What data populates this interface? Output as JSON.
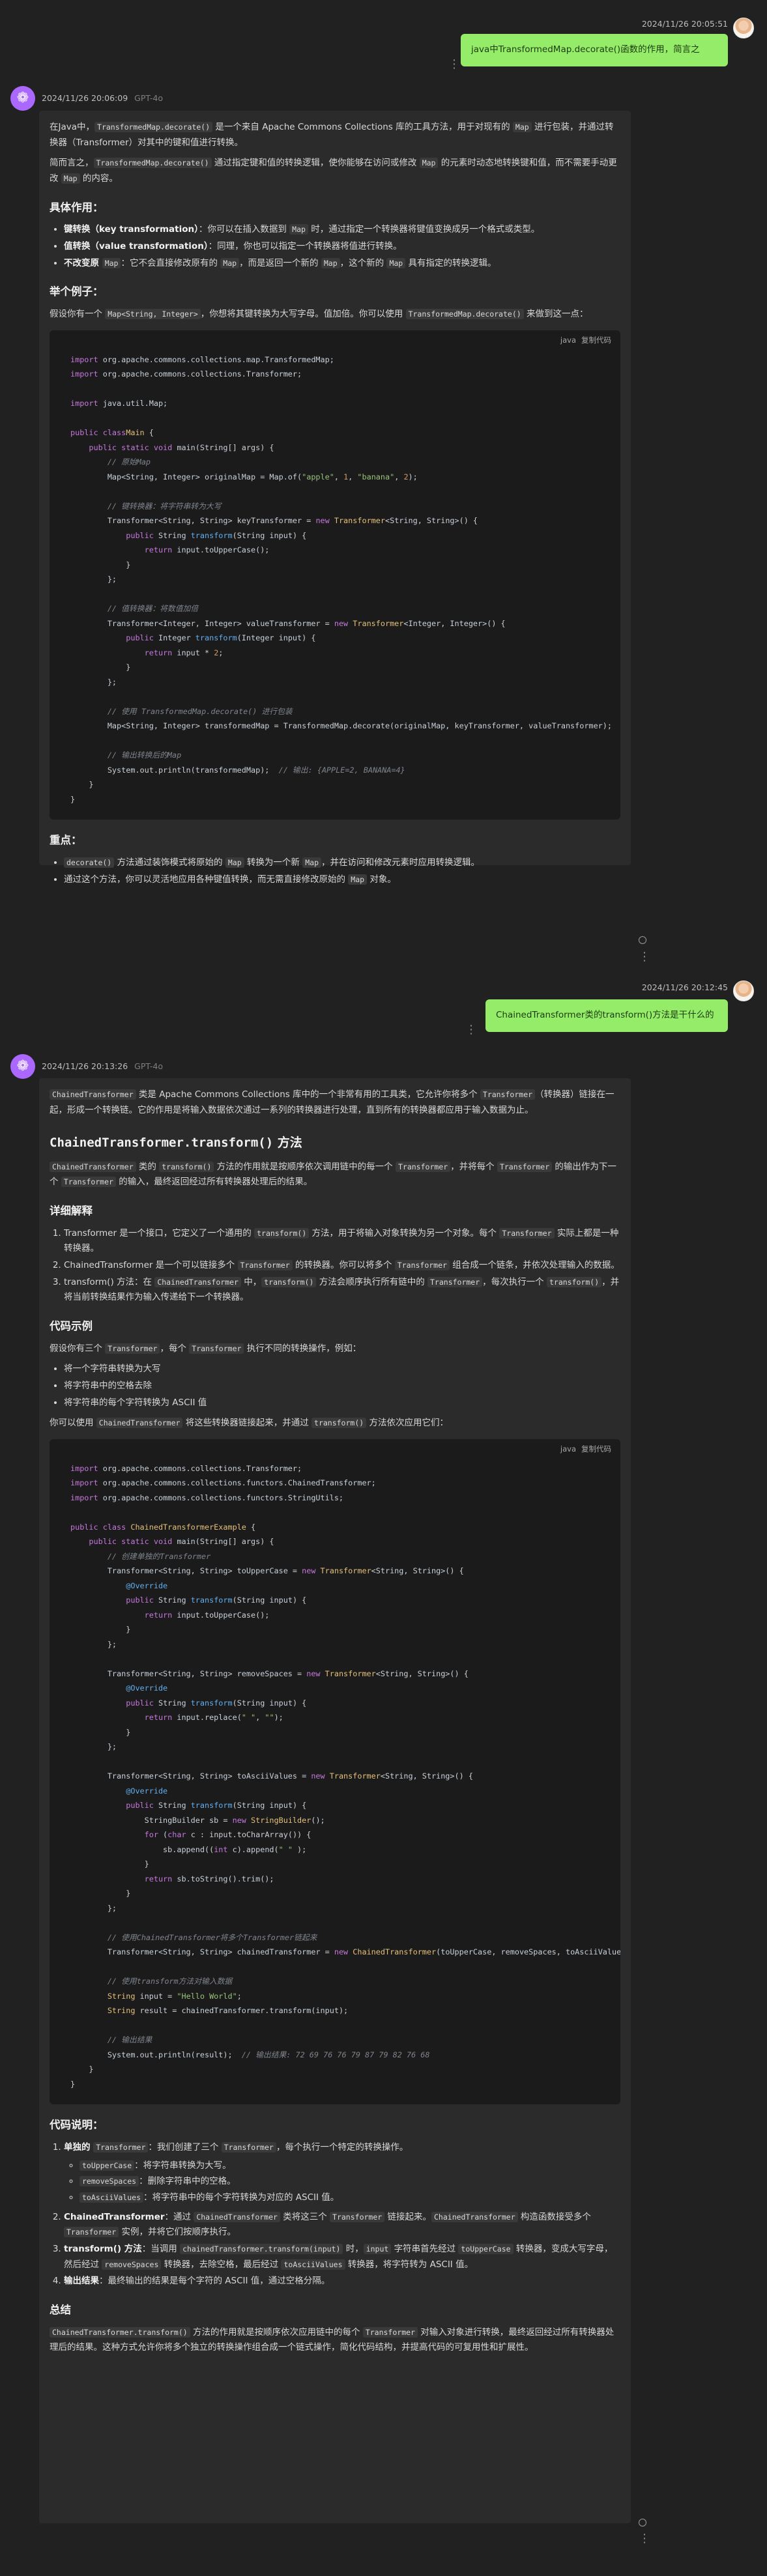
{
  "conversation": [
    {
      "role": "user",
      "timestamp": "2024/11/26 20:05:51",
      "text": "java中TransformedMap.decorate()函数的作用，简言之"
    },
    {
      "role": "assistant",
      "timestamp": "2024/11/26 20:06:09",
      "model": "GPT-4o",
      "p1_a": "在Java中，",
      "p1_code": "TransformedMap.decorate()",
      "p1_b": " 是一个来自 Apache Commons Collections 库的工具方法，用于对现有的 ",
      "p1_code2": "Map",
      "p1_c": " 进行包装，并通过转换器（Transformer）对其中的键和值进行转换。",
      "p2_a": "简而言之，",
      "p2_code": "TransformedMap.decorate()",
      "p2_b": " 通过指定键和值的转换逻辑，使你能够在访问或修改 ",
      "p2_code2": "Map",
      "p2_c": " 的元素时动态地转换键和值，而不需要手动更改 ",
      "p2_code3": "Map",
      "p2_d": " 的内容。",
      "h_role": "具体作用：",
      "role_items": [
        {
          "bold": "键转换（key transformation）",
          "a": "：你可以在插入数据到 ",
          "code": "Map",
          "b": " 时，通过指定一个转换器将键值变换成另一个格式或类型。"
        },
        {
          "bold": "值转换（value transformation）",
          "a": "：同理，你也可以指定一个转换器将值进行转换。",
          "code": "",
          "b": ""
        },
        {
          "bold": "不改变原 ",
          "code0": "Map",
          "a": "：它不会直接修改原有的 ",
          "code": "Map",
          "b": "，而是返回一个新的 ",
          "code2": "Map",
          "c": "，这个新的 ",
          "code3": "Map",
          "d": " 具有指定的转换逻辑。"
        }
      ],
      "h_example": "举个例子：",
      "ex_a": "假设你有一个 ",
      "ex_code": "Map<String, Integer>",
      "ex_b": "，你想将其键转换为大写字母。值加倍。你可以使用 ",
      "ex_code2": "TransformedMap.decorate()",
      "ex_c": " 来做到这一点：",
      "code_lang": "java",
      "code_copy": "复制代码",
      "h_focus": "重点：",
      "focus_items": [
        {
          "code": "decorate()",
          "a": " 方法通过装饰模式将原始的 ",
          "code2": "Map",
          "b": " 转换为一个新 ",
          "code3": "Map",
          "c": "，并在访问和修改元素时应用转换逻辑。"
        },
        {
          "a": "通过这个方法，你可以灵活地应用各种键值转换，而无需直接修改原始的 ",
          "code": "Map",
          "b": " 对象。"
        }
      ]
    },
    {
      "role": "user",
      "timestamp": "2024/11/26 20:12:45",
      "text": "ChainedTransformer类的transform()方法是干什么的"
    },
    {
      "role": "assistant",
      "timestamp": "2024/11/26 20:13:26",
      "model": "GPT-4o",
      "intro_code": "ChainedTransformer",
      "intro_a": " 类是 Apache Commons Collections 库中的一个非常有用的工具类，它允许你将多个 ",
      "intro_code2": "Transformer",
      "intro_b": "（转换器）链接在一起，形成一个转换链。它的作用是将输入数据依次通过一系列的转换器进行处理，直到所有的转换器都应用于输入数据为止。",
      "h_method_code": "ChainedTransformer.transform()",
      "h_method_b": " 方法",
      "m_code": "ChainedTransformer",
      "m_a": " 类的 ",
      "m_code2": "transform()",
      "m_b": " 方法的作用就是按顺序依次调用链中的每一个 ",
      "m_code3": "Transformer",
      "m_c": "，并将每个 ",
      "m_code4": "Transformer",
      "m_d": " 的输出作为下一个 ",
      "m_code5": "Transformer",
      "m_e": " 的输入，最终返回经过所有转换器处理后的结果。",
      "h_detail": "详细解释",
      "detail_items": [
        {
          "a": "Transformer 是一个接口，它定义了一个通用的 ",
          "code": "transform()",
          "b": " 方法，用于将输入对象转换为另一个对象。每个 ",
          "code2": "Transformer",
          "c": " 实际上都是一种转换器。"
        },
        {
          "a": "ChainedTransformer 是一个可以链接多个 ",
          "code": "Transformer",
          "b": " 的转换器。你可以将多个 ",
          "code2": "Transformer",
          "c": " 组合成一个链条，并依次处理输入的数据。"
        },
        {
          "a": "transform() 方法：在 ",
          "code": "ChainedTransformer",
          "b": " 中，",
          "code2": "transform()",
          "c": " 方法会顺序执行所有链中的 ",
          "code3": "Transformer",
          "d": "，每次执行一个 ",
          "code4": "transform()",
          "e": "，并将当前转换结果作为输入传递给下一个转换器。"
        }
      ],
      "h_code_ex": "代码示例",
      "ce_a": "假设你有三个 ",
      "ce_code": "Transformer",
      "ce_b": "，每个 ",
      "ce_code2": "Transformer",
      "ce_c": " 执行不同的转换操作，例如：",
      "ce_items": [
        "将一个字符串转换为大写",
        "将字符串中的空格去除",
        "将字符串的每个字符转换为 ASCII 值"
      ],
      "ce2_a": "你可以使用 ",
      "ce2_code": "ChainedTransformer",
      "ce2_b": " 将这些转换器链接起来，并通过 ",
      "ce2_code2": "transform()",
      "ce2_c": " 方法依次应用它们：",
      "code_lang": "java",
      "code_copy": "复制代码",
      "h_explain": "代码说明：",
      "explain_items": [
        {
          "bold": "单独的 ",
          "code": "Transformer",
          "a": "：我们创建了三个 ",
          "code2": "Transformer",
          "b": "，每个执行一个特定的转换操作。",
          "sub": [
            {
              "code": "toUpperCase",
              "a": "：将字符串转换为大写。"
            },
            {
              "code": "removeSpaces",
              "a": "：删除字符串中的空格。"
            },
            {
              "code": "toAsciiValues",
              "a": "：将字符串中的每个字符转换为对应的 ASCII 值。"
            }
          ]
        },
        {
          "bold": "ChainedTransformer",
          "a": "：通过 ",
          "code": "ChainedTransformer",
          "b": " 类将这三个 ",
          "code2": "Transformer",
          "c": " 链接起来。",
          "code3": "ChainedTransformer",
          "d": " 构造函数接受多个 ",
          "code4": "Transformer",
          "e": " 实例，并将它们按顺序执行。"
        },
        {
          "bold": "transform() 方法",
          "a": "：当调用 ",
          "code": "chainedTransformer.transform(input)",
          "b": " 时，",
          "code2": "input",
          "c": " 字符串首先经过 ",
          "code3": "toUpperCase",
          "d": " 转换器，变成大写字母，然后经过 ",
          "code4": "removeSpaces",
          "e": " 转换器，去除空格，最后经过 ",
          "code5": "toAsciiValues",
          "f": " 转换器，将字符转为 ASCII 值。"
        },
        {
          "bold": "输出结果",
          "a": "：最终输出的结果是每个字符的 ASCII 值，通过空格分隔。"
        }
      ],
      "h_summary": "总结",
      "sum_code": "ChainedTransformer.transform()",
      "sum_a": " 方法的作用就是按顺序依次应用链中的每个 ",
      "sum_code2": "Transformer",
      "sum_b": " 对输入对象进行转换，最终返回经过所有转换器处理后的结果。这种方式允许你将多个独立的转换操作组合成一个链式操作，简化代码结构，并提高代码的可复用性和扩展性。"
    }
  ],
  "code1": [
    [
      [
        "kw",
        "import"
      ],
      [
        "",
        "org.apache.commons.collections.map.TransformedMap;"
      ]
    ],
    [
      [
        "kw",
        "import"
      ],
      [
        "",
        "org.apache.commons.collections.Transformer;"
      ]
    ],
    [],
    [
      [
        "kw",
        "import"
      ],
      [
        "",
        "java.util.Map;"
      ]
    ],
    [],
    [
      [
        "kw",
        "public class"
      ],
      [
        "ty",
        "Main"
      ],
      [
        "",
        " {"
      ]
    ],
    [
      [
        "",
        "    "
      ],
      [
        "kw",
        "public static void"
      ],
      [
        "",
        " main(String[] args) {"
      ]
    ],
    [
      [
        "cm",
        "        // 原始Map"
      ]
    ],
    [
      [
        "",
        "        Map<String, Integer> originalMap = Map.of("
      ],
      [
        "str",
        "\"apple\""
      ],
      [
        "",
        ", "
      ],
      [
        "nb",
        "1"
      ],
      [
        "",
        ", "
      ],
      [
        "str",
        "\"banana\""
      ],
      [
        "",
        ", "
      ],
      [
        "nb",
        "2"
      ],
      [
        "",
        ");"
      ]
    ],
    [],
    [
      [
        "cm",
        "        // 键转换器：将字符串转为大写"
      ]
    ],
    [
      [
        "",
        "        Transformer<String, String> keyTransformer = "
      ],
      [
        "kw",
        "new"
      ],
      [
        "ty",
        " Transformer"
      ],
      [
        "",
        "<String, String>() {"
      ]
    ],
    [
      [
        "",
        "            "
      ],
      [
        "kw",
        "public"
      ],
      [
        "",
        " String "
      ],
      [
        "an",
        "transform"
      ],
      [
        "",
        "(String input) {"
      ]
    ],
    [
      [
        "",
        "                "
      ],
      [
        "kw",
        "return"
      ],
      [
        "",
        " input.toUpperCase();"
      ]
    ],
    [
      [
        "",
        "            }"
      ]
    ],
    [
      [
        "",
        "        };"
      ]
    ],
    [],
    [
      [
        "cm",
        "        // 值转换器：将数值加倍"
      ]
    ],
    [
      [
        "",
        "        Transformer<Integer, Integer> valueTransformer = "
      ],
      [
        "kw",
        "new"
      ],
      [
        "ty",
        " Transformer"
      ],
      [
        "",
        "<Integer, Integer>() {"
      ]
    ],
    [
      [
        "",
        "            "
      ],
      [
        "kw",
        "public"
      ],
      [
        "",
        " Integer "
      ],
      [
        "an",
        "transform"
      ],
      [
        "",
        "(Integer input) {"
      ]
    ],
    [
      [
        "",
        "                "
      ],
      [
        "kw",
        "return"
      ],
      [
        "",
        " input * "
      ],
      [
        "nb",
        "2"
      ],
      [
        "",
        ";"
      ]
    ],
    [
      [
        "",
        "            }"
      ]
    ],
    [
      [
        "",
        "        };"
      ]
    ],
    [],
    [
      [
        "cm",
        "        // 使用 TransformedMap.decorate() 进行包装"
      ]
    ],
    [
      [
        "",
        "        Map<String, Integer> transformedMap = TransformedMap.decorate(originalMap, keyTransformer, valueTransformer);"
      ]
    ],
    [],
    [
      [
        "cm",
        "        // 输出转换后的Map"
      ]
    ],
    [
      [
        "",
        "        System.out.println(transformedMap);  "
      ],
      [
        "cm",
        "// 输出: {APPLE=2, BANANA=4}"
      ]
    ],
    [
      [
        "",
        "    }"
      ]
    ],
    [
      [
        "",
        "}"
      ]
    ]
  ],
  "code2": [
    [
      [
        "kw",
        "import"
      ],
      [
        "",
        "org.apache.commons.collections.Transformer;"
      ]
    ],
    [
      [
        "kw",
        "import"
      ],
      [
        "",
        "org.apache.commons.collections.functors.ChainedTransformer;"
      ]
    ],
    [
      [
        "kw",
        "import"
      ],
      [
        "",
        "org.apache.commons.collections.functors.StringUtils;"
      ]
    ],
    [],
    [
      [
        "kw",
        "public class"
      ],
      [
        "ty",
        " ChainedTransformerExample"
      ],
      [
        "",
        " {"
      ]
    ],
    [
      [
        "",
        "    "
      ],
      [
        "kw",
        "public static void"
      ],
      [
        "",
        " main(String[] args) {"
      ]
    ],
    [
      [
        "cm",
        "        // 创建单独的Transformer"
      ]
    ],
    [
      [
        "",
        "        Transformer<String, String> toUpperCase = "
      ],
      [
        "kw",
        "new"
      ],
      [
        "ty",
        " Transformer"
      ],
      [
        "",
        "<String, String>() {"
      ]
    ],
    [
      [
        "",
        "            "
      ],
      [
        "an",
        "@Override"
      ]
    ],
    [
      [
        "",
        "            "
      ],
      [
        "kw",
        "public"
      ],
      [
        "",
        " String "
      ],
      [
        "an",
        "transform"
      ],
      [
        "",
        "(String input) {"
      ]
    ],
    [
      [
        "",
        "                "
      ],
      [
        "kw",
        "return"
      ],
      [
        "",
        " input.toUpperCase();"
      ]
    ],
    [
      [
        "",
        "            }"
      ]
    ],
    [
      [
        "",
        "        };"
      ]
    ],
    [],
    [
      [
        "",
        "        Transformer<String, String> removeSpaces = "
      ],
      [
        "kw",
        "new"
      ],
      [
        "ty",
        " Transformer"
      ],
      [
        "",
        "<String, String>() {"
      ]
    ],
    [
      [
        "",
        "            "
      ],
      [
        "an",
        "@Override"
      ]
    ],
    [
      [
        "",
        "            "
      ],
      [
        "kw",
        "public"
      ],
      [
        "",
        " String "
      ],
      [
        "an",
        "transform"
      ],
      [
        "",
        "(String input) {"
      ]
    ],
    [
      [
        "",
        "                "
      ],
      [
        "kw",
        "return"
      ],
      [
        "",
        " input.replace("
      ],
      [
        "str",
        "\" \""
      ],
      [
        "",
        ", "
      ],
      [
        "str",
        "\"\""
      ],
      [
        "",
        ");"
      ]
    ],
    [
      [
        "",
        "            }"
      ]
    ],
    [
      [
        "",
        "        };"
      ]
    ],
    [],
    [
      [
        "",
        "        Transformer<String, String> toAsciiValues = "
      ],
      [
        "kw",
        "new"
      ],
      [
        "ty",
        " Transformer"
      ],
      [
        "",
        "<String, String>() {"
      ]
    ],
    [
      [
        "",
        "            "
      ],
      [
        "an",
        "@Override"
      ]
    ],
    [
      [
        "",
        "            "
      ],
      [
        "kw",
        "public"
      ],
      [
        "",
        " String "
      ],
      [
        "an",
        "transform"
      ],
      [
        "",
        "(String input) {"
      ]
    ],
    [
      [
        "",
        "                StringBuilder sb = "
      ],
      [
        "kw",
        "new"
      ],
      [
        "ty",
        " StringBuilder"
      ],
      [
        "",
        "();"
      ]
    ],
    [
      [
        "",
        "                "
      ],
      [
        "kw",
        "for"
      ],
      [
        "",
        " ("
      ],
      [
        "kw",
        "char"
      ],
      [
        "",
        " c : input.toCharArray()) {"
      ]
    ],
    [
      [
        "",
        "                    sb.append(("
      ],
      [
        "kw",
        "int"
      ],
      [
        "",
        " c).append("
      ],
      [
        "str",
        "\" \""
      ],
      [
        "",
        " );"
      ]
    ],
    [
      [
        "",
        "                }"
      ]
    ],
    [
      [
        "",
        "                "
      ],
      [
        "kw",
        "return"
      ],
      [
        "",
        " sb.toString().trim();"
      ]
    ],
    [
      [
        "",
        "            }"
      ]
    ],
    [
      [
        "",
        "        };"
      ]
    ],
    [],
    [
      [
        "cm",
        "        // 使用ChainedTransformer将多个Transformer链起来"
      ]
    ],
    [
      [
        "",
        "        Transformer<String, String> chainedTransformer = "
      ],
      [
        "kw",
        "new"
      ],
      [
        "ty",
        " ChainedTransformer"
      ],
      [
        "",
        "(toUpperCase, removeSpaces, toAsciiValues);"
      ]
    ],
    [],
    [
      [
        "cm",
        "        // 使用transform方法对输入数据"
      ]
    ],
    [
      [
        "ty",
        "        String"
      ],
      [
        "",
        " input = "
      ],
      [
        "str",
        "\"Hello World\""
      ],
      [
        "",
        ";"
      ]
    ],
    [
      [
        "ty",
        "        String"
      ],
      [
        "",
        " result = chainedTransformer.transform(input);"
      ]
    ],
    [],
    [
      [
        "cm",
        "        // 输出结果"
      ]
    ],
    [
      [
        "",
        "        System.out.println(result);  "
      ],
      [
        "cm",
        "// 输出结果: 72 69 76 76 79 87 79 82 76 68"
      ]
    ],
    [
      [
        "",
        "    }"
      ]
    ],
    [
      [
        "",
        "}"
      ]
    ]
  ]
}
